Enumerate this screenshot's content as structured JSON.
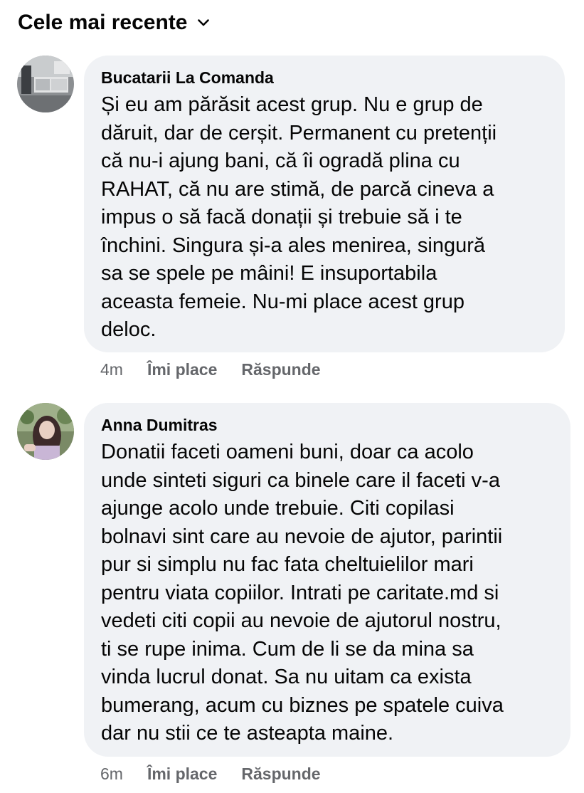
{
  "sort": {
    "label": "Cele mai recente",
    "icon": "chevron-down-icon"
  },
  "comments": [
    {
      "author": "Bucatarii La Comanda",
      "text": "Și eu am părăsit acest grup. Nu e grup de\ndăruit, dar de cerșit. Permanent cu pretenții\ncă nu-i ajung bani, că îi ogradă plina cu\nRAHAT, că nu are stimă, de parcă cineva a\nimpus o să facă donații și trebuie să i te\nînchini. Singura și-a ales menirea, singură\nsa se spele pe mâini! E insuportabila\naceasta femeie. Nu-mi place acest grup\ndeloc.",
      "time": "4m",
      "like_label": "Îmi place",
      "reply_label": "Răspunde"
    },
    {
      "author": "Anna Dumitras",
      "text": "Donatii faceti oameni buni, doar ca acolo\nunde sinteti siguri ca binele care il faceti v-a\najunge acolo unde trebuie. Citi copilasi\nbolnavi sint care au nevoie de ajutor, parintii\npur si simplu nu fac fata cheltuielilor mari\npentru viata copiilor. Intrati pe caritate.md si\nvedeti citi copii au nevoie de ajutorul nostru,\nti se rupe inima. Cum de li se da mina sa\nvinda lucrul donat. Sa nu uitam ca exista\nbumerang, acum cu biznes pe spatele cuiva\ndar nu stii ce te asteapta maine.",
      "time": "6m",
      "like_label": "Îmi place",
      "reply_label": "Răspunde"
    }
  ],
  "colors": {
    "bubble": "#f0f2f5",
    "meta": "#65676b",
    "text": "#050505"
  }
}
